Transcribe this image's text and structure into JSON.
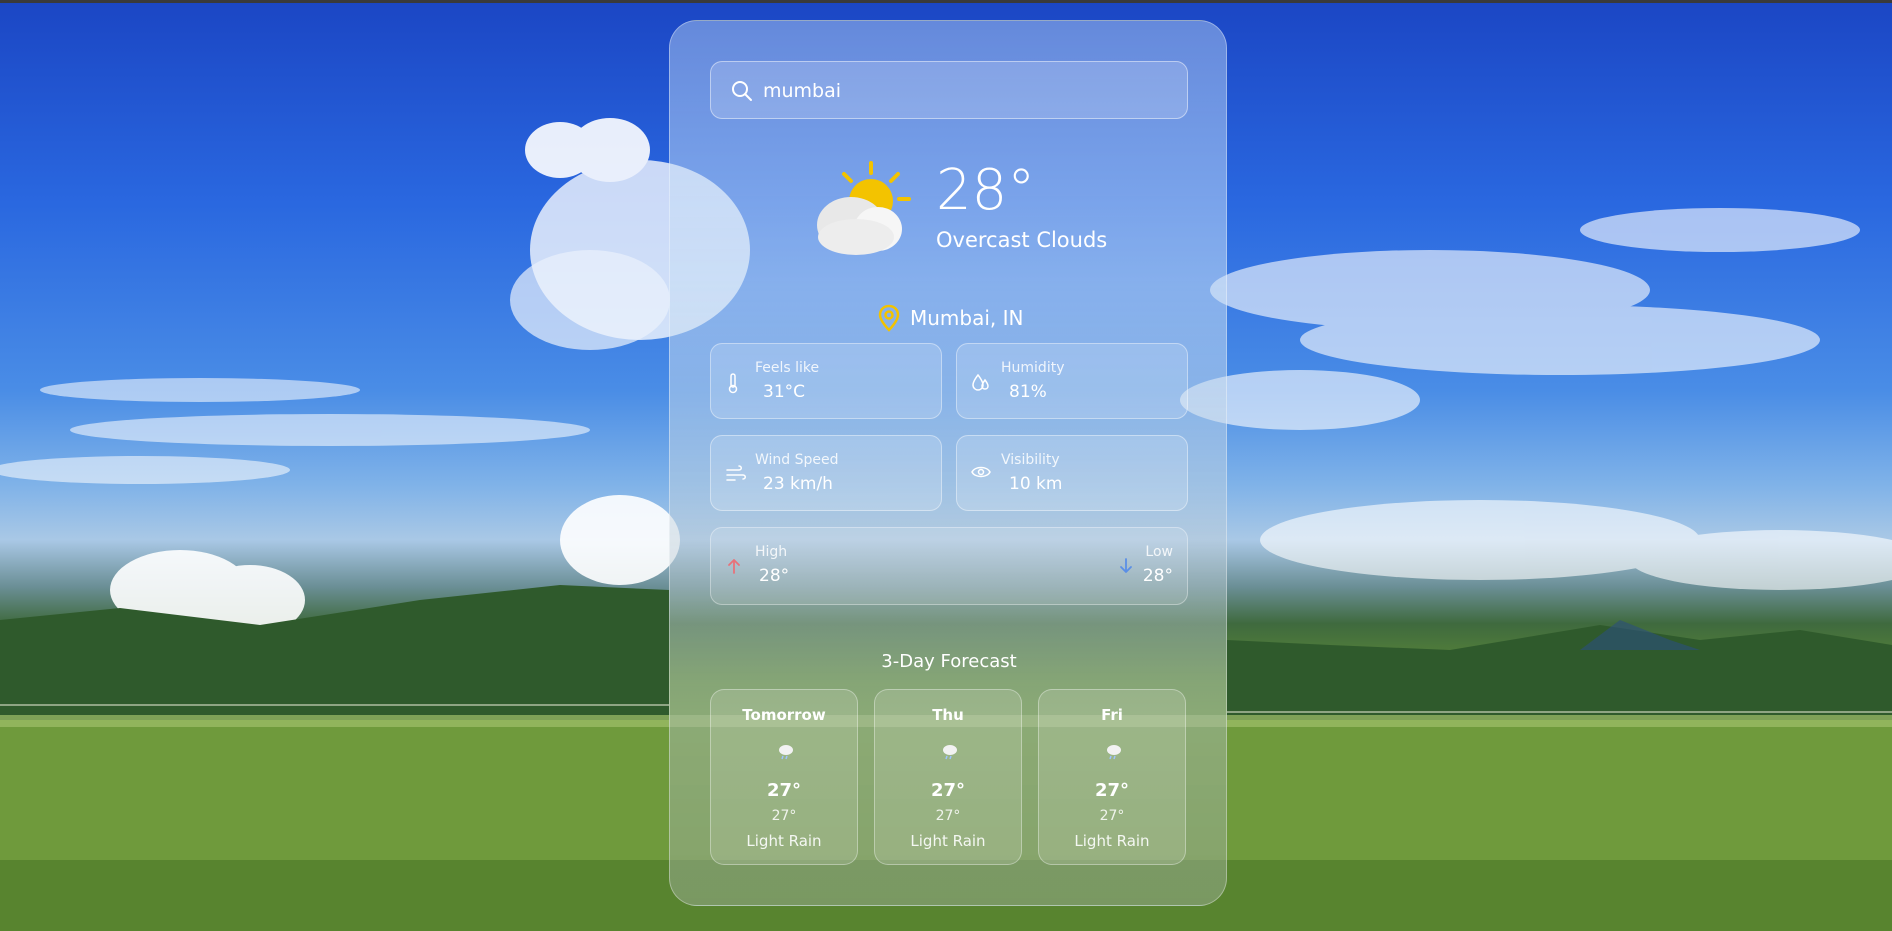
{
  "search": {
    "value": "mumbai",
    "placeholder": ""
  },
  "current": {
    "temperature": "28°",
    "condition": "Overcast Clouds",
    "location": "Mumbai, IN",
    "icon": "sun-behind-cloud-icon"
  },
  "details": {
    "feels_like": {
      "label": "Feels like",
      "value": "31°C",
      "icon": "thermometer-icon"
    },
    "humidity": {
      "label": "Humidity",
      "value": "81%",
      "icon": "droplets-icon"
    },
    "wind_speed": {
      "label": "Wind Speed",
      "value": "23 km/h",
      "icon": "wind-icon"
    },
    "visibility": {
      "label": "Visibility",
      "value": "10 km",
      "icon": "eye-icon"
    }
  },
  "high_low": {
    "high_label": "High",
    "high_value": "28°",
    "low_label": "Low",
    "low_value": "28°",
    "high_color": "#e8727a",
    "low_color": "#5b8fe6"
  },
  "forecast": {
    "title": "3-Day Forecast",
    "days": [
      {
        "name": "Tomorrow",
        "high": "27°",
        "low": "27°",
        "desc": "Light Rain",
        "icon": "rain-cloud-icon"
      },
      {
        "name": "Thu",
        "high": "27°",
        "low": "27°",
        "desc": "Light Rain",
        "icon": "rain-cloud-icon"
      },
      {
        "name": "Fri",
        "high": "27°",
        "low": "27°",
        "desc": "Light Rain",
        "icon": "rain-cloud-icon"
      }
    ]
  },
  "colors": {
    "sun": "#f3c300",
    "pin": "#f3c300"
  }
}
